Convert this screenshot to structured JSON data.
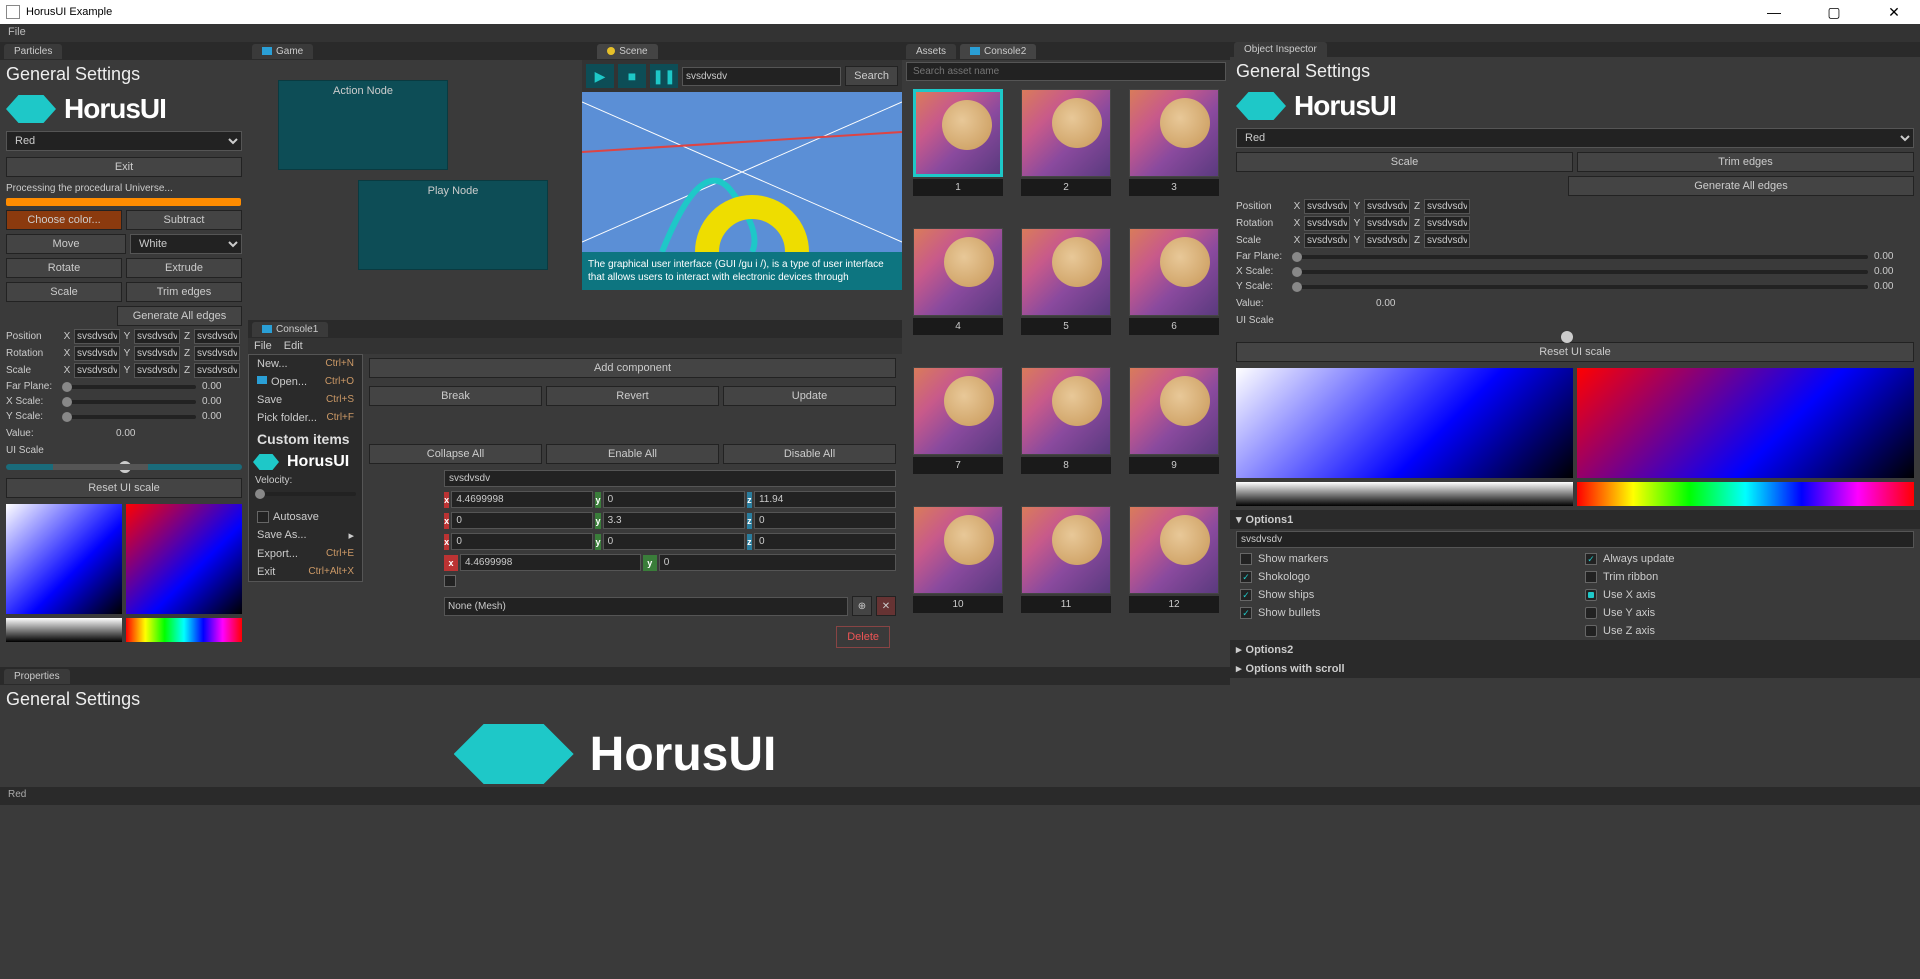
{
  "window": {
    "title": "HorusUI Example"
  },
  "menubar": {
    "file": "File"
  },
  "brand": "HorusUI",
  "particles": {
    "tab": "Particles",
    "title": "General Settings",
    "color_select": "Red",
    "exit": "Exit",
    "status": "Processing the procedural Universe...",
    "choose_color": "Choose color...",
    "subtract": "Subtract",
    "move": "Move",
    "white_select": "White",
    "rotate": "Rotate",
    "extrude": "Extrude",
    "scale": "Scale",
    "trim_edges": "Trim edges",
    "gen_edges": "Generate All edges",
    "position": "Position",
    "rotation": "Rotation",
    "scale_lbl": "Scale",
    "vec_val": "svsdvsdv",
    "far_plane": "Far Plane:",
    "xscale": "X Scale:",
    "yscale": "Y Scale:",
    "zero": "0.00",
    "value_lbl": "Value:",
    "value": "0.00",
    "ui_scale": "UI Scale",
    "reset_ui": "Reset UI scale"
  },
  "game": {
    "tab": "Game",
    "action_node": "Action Node",
    "play_node": "Play Node"
  },
  "scene": {
    "tab": "Scene",
    "search_val": "svsdvsdv",
    "search_btn": "Search",
    "info": "The graphical user interface (GUI /gu i /), is a type of user interface that allows users to interact with electronic devices through"
  },
  "console1": {
    "tab": "Console1",
    "file": "File",
    "edit": "Edit",
    "menu": {
      "new": "New...",
      "new_sc": "Ctrl+N",
      "open": "Open...",
      "open_sc": "Ctrl+O",
      "save": "Save",
      "save_sc": "Ctrl+S",
      "pick": "Pick folder...",
      "pick_sc": "Ctrl+F",
      "autosave": "Autosave",
      "saveas": "Save As...",
      "export": "Export...",
      "export_sc": "Ctrl+E",
      "exit": "Exit",
      "exit_sc": "Ctrl+Alt+X"
    },
    "custom_items": "Custom items",
    "velocity": "Velocity:",
    "add_component": "Add component",
    "break": "Break",
    "revert": "Revert",
    "update": "Update",
    "collapse": "Collapse All",
    "enable": "Enable All",
    "disable": "Disable All",
    "name_val": "svsdvsdv",
    "v1": {
      "x": "4.4699998",
      "y": "0",
      "z": "11.94"
    },
    "v2": {
      "x": "0",
      "y": "3.3",
      "z": "0"
    },
    "v3": {
      "x": "0",
      "y": "0",
      "z": "0"
    },
    "v4": {
      "x": "4.4699998",
      "y": "0"
    },
    "mesh": "None (Mesh)",
    "delete": "Delete"
  },
  "assets": {
    "tab": "Assets",
    "console2_tab": "Console2",
    "search_placeholder": "Search asset name",
    "items": [
      "1",
      "2",
      "3",
      "4",
      "5",
      "6",
      "7",
      "8",
      "9",
      "10",
      "11",
      "12"
    ]
  },
  "inspector": {
    "tab": "Object Inspector",
    "title": "General Settings",
    "color_select": "Red",
    "scale_btn": "Scale",
    "trim_btn": "Trim edges",
    "gen_btn": "Generate All edges",
    "position": "Position",
    "rotation": "Rotation",
    "scale_lbl": "Scale",
    "vec_val": "svsdvsdv",
    "far_plane": "Far Plane:",
    "xscale": "X Scale:",
    "yscale": "Y Scale:",
    "zero": "0.00",
    "value_lbl": "Value:",
    "value": "0.00",
    "ui_scale": "UI Scale",
    "reset_ui": "Reset UI scale",
    "options1": "Options1",
    "opt_text": "svsdvsdv",
    "show_markers": "Show markers",
    "shokologo": "Shokologo",
    "show_ships": "Show ships",
    "show_bullets": "Show bullets",
    "always_update": "Always update",
    "trim_ribbon": "Trim ribbon",
    "use_x": "Use X axis",
    "use_y": "Use Y axis",
    "use_z": "Use Z axis",
    "options2": "Options2",
    "options_scroll": "Options with scroll"
  },
  "properties": {
    "tab": "Properties",
    "title": "General Settings"
  },
  "status": "Red"
}
